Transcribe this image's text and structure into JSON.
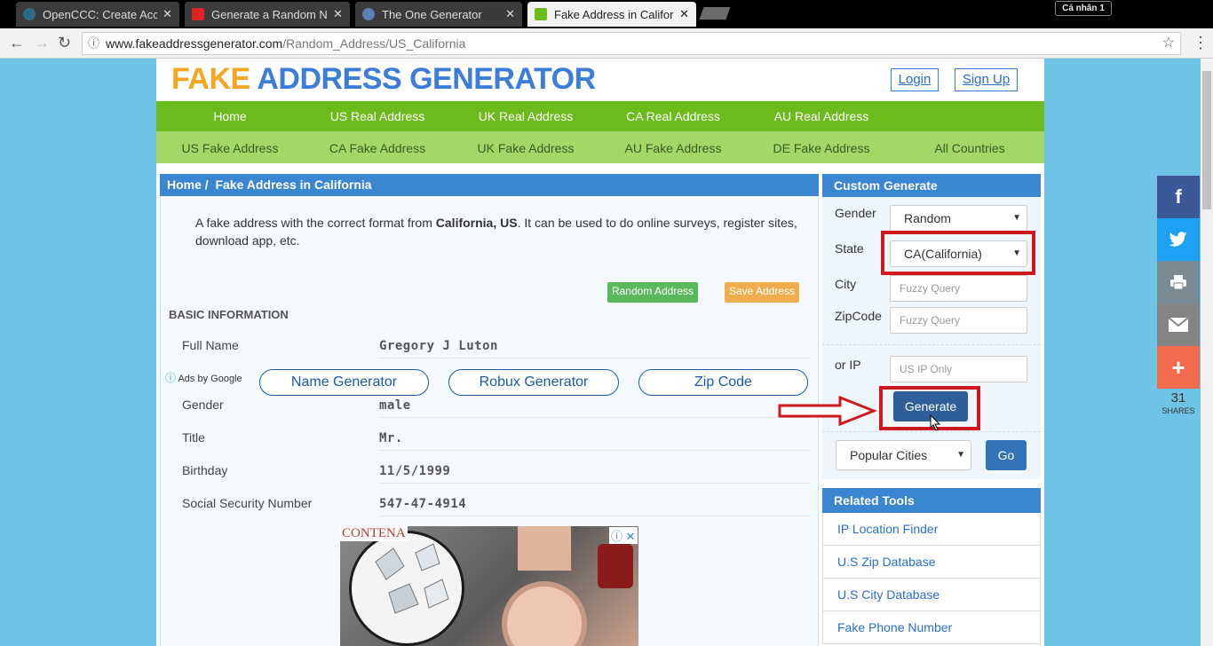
{
  "browser": {
    "tabs": [
      {
        "title": "OpenCCC: Create Accou",
        "close": "✕"
      },
      {
        "title": "Generate a Random Nam",
        "close": "✕"
      },
      {
        "title": "The One Generator",
        "close": "✕"
      },
      {
        "title": "Fake Address in Californi",
        "close": "✕"
      }
    ],
    "profile": "Cá nhân 1",
    "url_host": "www.fakeaddressgenerator.com",
    "url_path": "/Random_Address/US_California"
  },
  "header": {
    "logo_part1": "FAKE",
    "logo_part2": "ADDRESS GENERATOR",
    "login": "Login",
    "signup": "Sign Up"
  },
  "nav_primary": [
    "Home",
    "US Real Address",
    "UK Real Address",
    "CA Real Address",
    "AU Real Address"
  ],
  "nav_secondary": [
    "US Fake Address",
    "CA Fake Address",
    "UK Fake Address",
    "AU Fake Address",
    "DE Fake Address",
    "All Countries"
  ],
  "breadcrumb": {
    "home": "Home",
    "sep": "/",
    "current": "Fake Address in California"
  },
  "intro": {
    "pre": "A fake address with the correct format from ",
    "bold": "California, US",
    "post": ". It can be used to do online surveys, register sites, download app, etc."
  },
  "buttons": {
    "random": "Random Address",
    "save": "Save Address"
  },
  "basic_info": {
    "heading": "BASIC INFORMATION",
    "rows": [
      {
        "label": "Full Name",
        "value": "Gregory J Luton"
      },
      {
        "label": "Gender",
        "value": "male"
      },
      {
        "label": "Title",
        "value": "Mr."
      },
      {
        "label": "Birthday",
        "value": "11/5/1999"
      },
      {
        "label": "Social Security Number",
        "value": "547-47-4914"
      }
    ]
  },
  "ads": {
    "label": "Ads by Google",
    "links": [
      "Name Generator",
      "Robux Generator",
      "Zip Code"
    ],
    "image_label": "CONTENA",
    "adchoices": "ⓘ ✕"
  },
  "custom_generate": {
    "title": "Custom Generate",
    "gender_label": "Gender",
    "gender_value": "Random",
    "state_label": "State",
    "state_value": "CA(California)",
    "city_label": "City",
    "city_placeholder": "Fuzzy Query",
    "zip_label": "ZipCode",
    "zip_placeholder": "Fuzzy Query",
    "ip_label": "or IP",
    "ip_placeholder": "US IP Only",
    "generate": "Generate",
    "popular_cities": "Popular Cities",
    "go": "Go"
  },
  "related_tools": {
    "title": "Related Tools",
    "items": [
      "IP Location Finder",
      "U.S Zip Database",
      "U.S City Database",
      "Fake Phone Number"
    ]
  },
  "social": {
    "icons": [
      "facebook-icon",
      "twitter-icon",
      "print-icon",
      "email-icon",
      "plus-icon"
    ],
    "count": "31",
    "label": "SHARES"
  },
  "colors": {
    "nav_primary": "#6cbb1c",
    "nav_secondary": "#a3d868",
    "panel_header": "#3b86d1",
    "highlight": "#d0191f",
    "page_bg": "#6ec3e6"
  }
}
